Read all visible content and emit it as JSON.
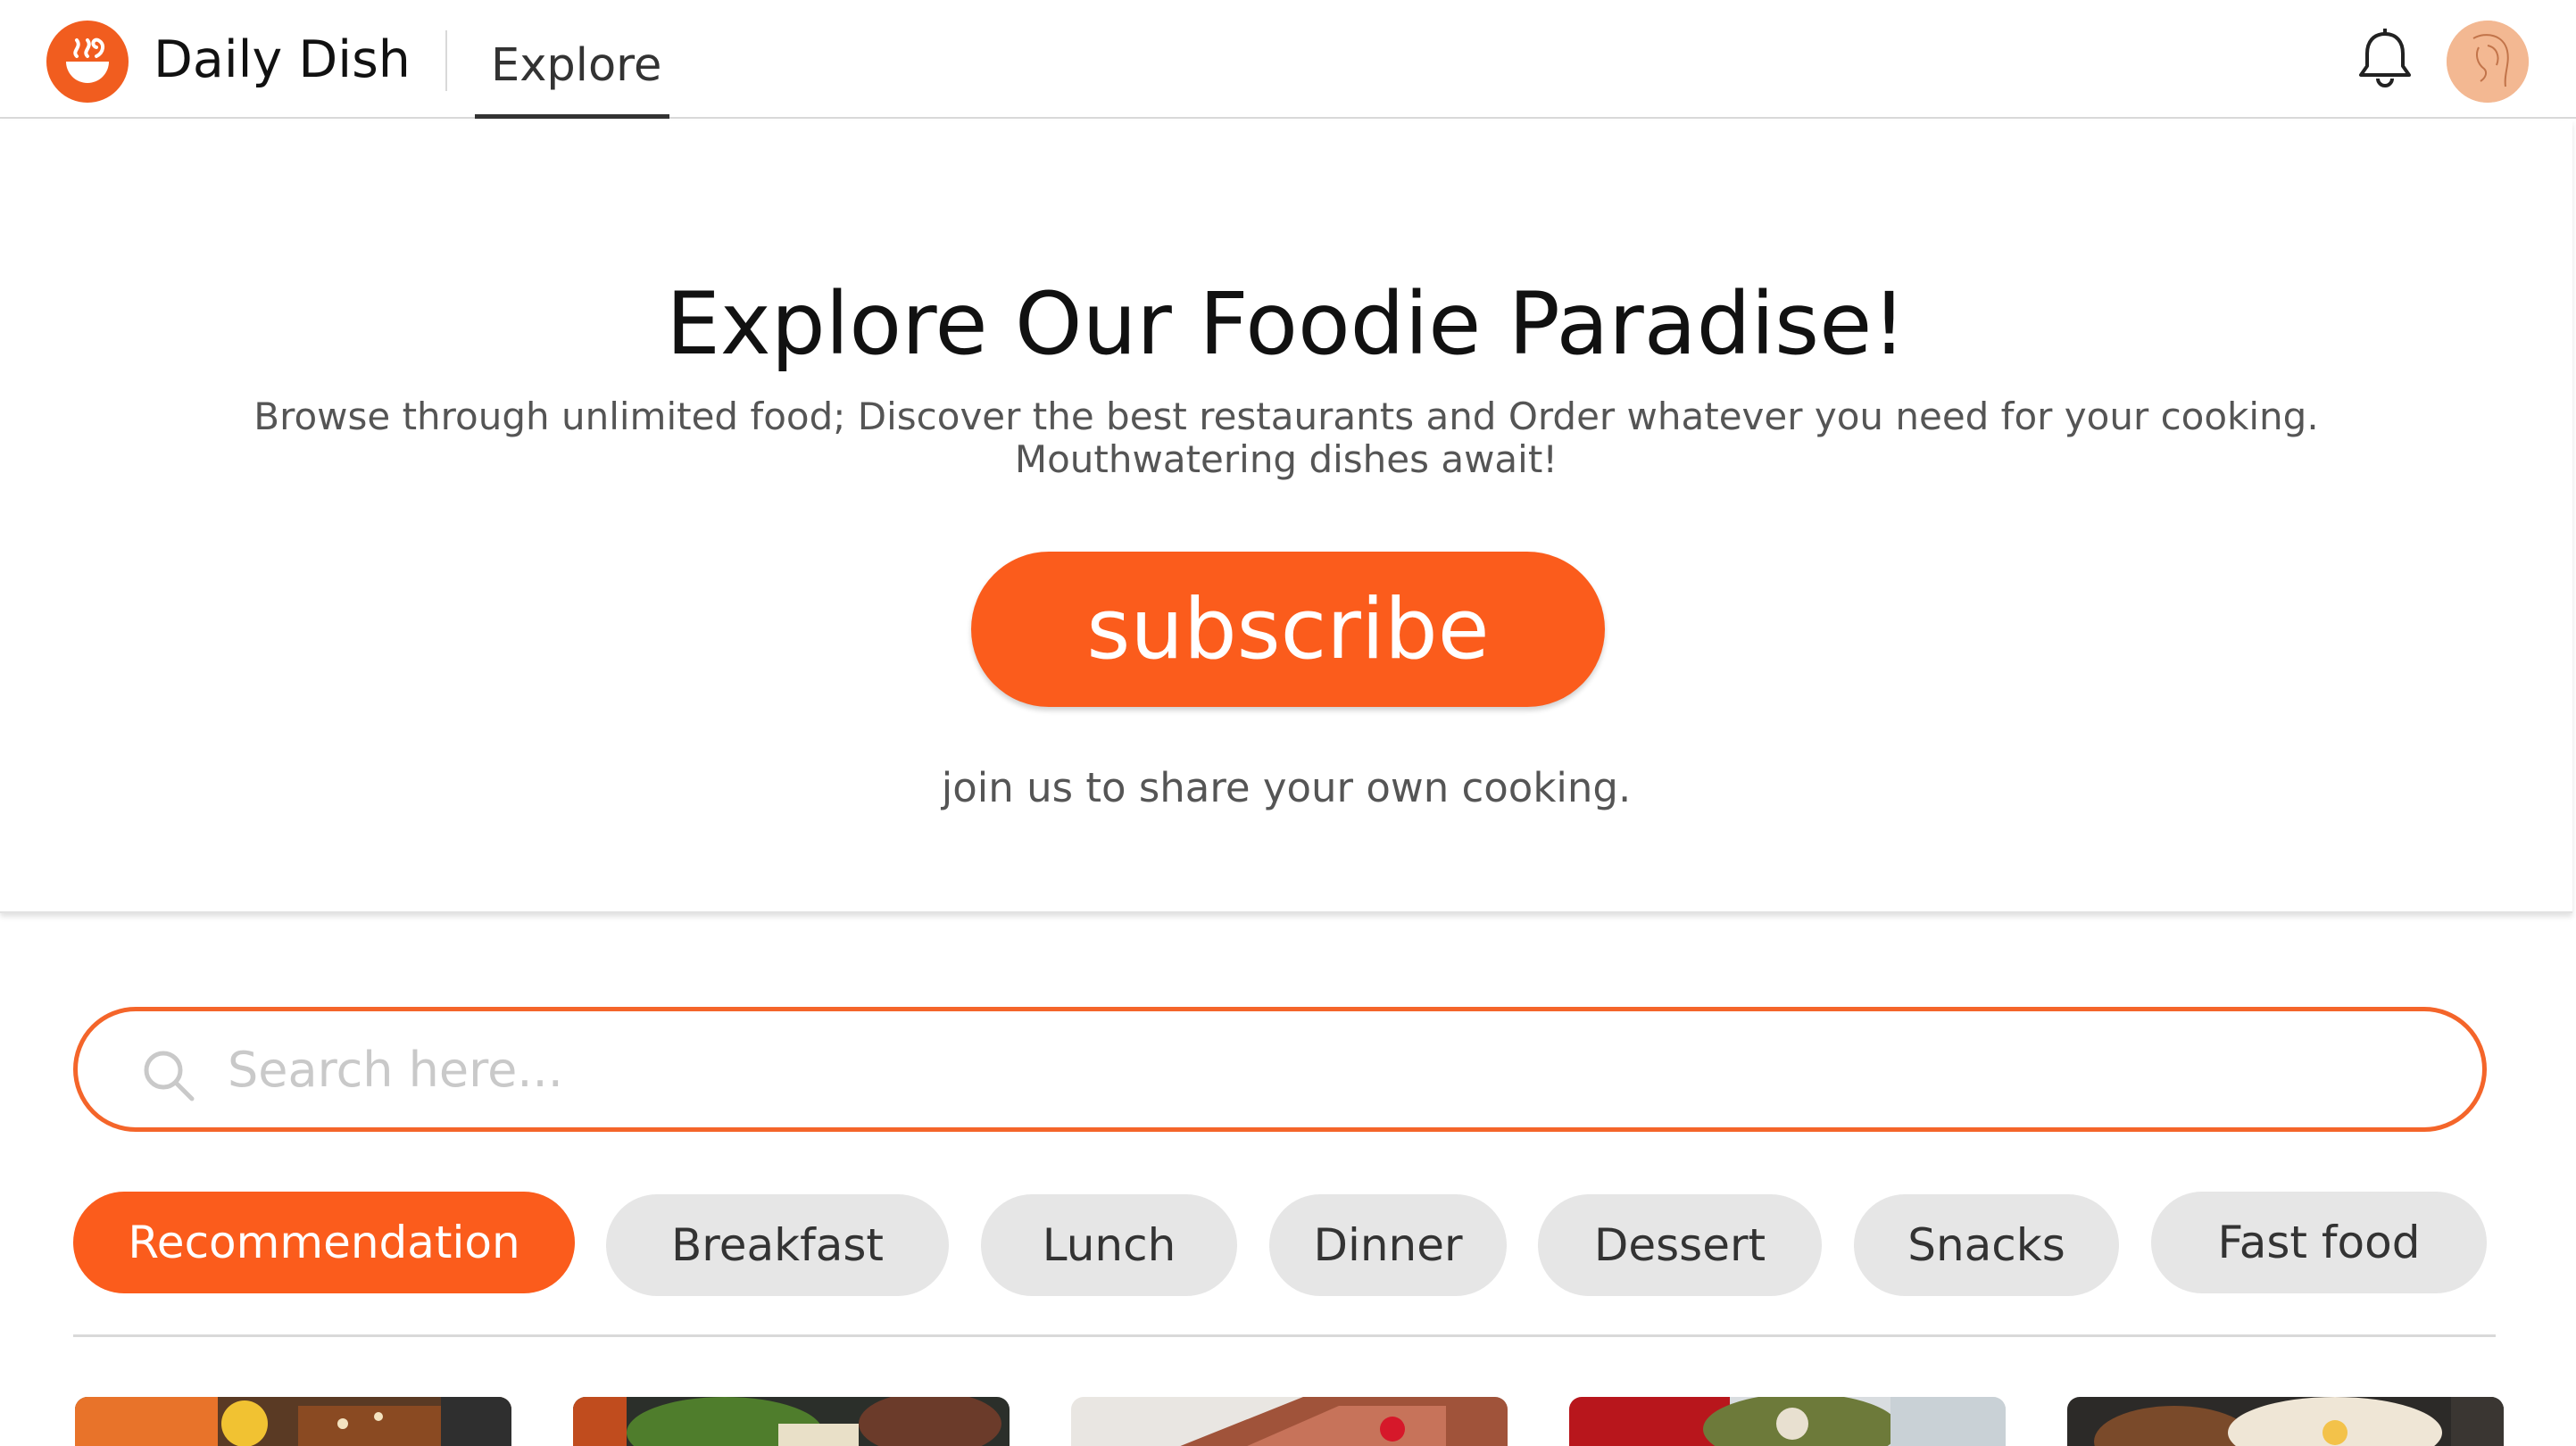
{
  "navbar": {
    "brand": "Daily Dish",
    "tab": "Explore"
  },
  "hero": {
    "title": "Explore Our Foodie Paradise!",
    "subtitle_line1": "Browse through unlimited food; Discover the best restaurants and Order whatever you need for your cooking.",
    "subtitle_line2": "Mouthwatering dishes await!",
    "subscribe_label": "subscribe",
    "note": "join us to share your own cooking."
  },
  "search": {
    "placeholder": "Search here..."
  },
  "categories": [
    {
      "label": "Recommendation",
      "active": true
    },
    {
      "label": "Breakfast",
      "active": false
    },
    {
      "label": "Lunch",
      "active": false
    },
    {
      "label": "Dinner",
      "active": false
    },
    {
      "label": "Dessert",
      "active": false
    },
    {
      "label": "Snacks",
      "active": false
    },
    {
      "label": "Fast food",
      "active": false
    }
  ],
  "colors": {
    "accent": "#fb5c1c",
    "chip_inactive": "#e6e6e6",
    "text_dark": "#111111",
    "text_muted": "#555555"
  },
  "icons": {
    "logo": "bowl-with-steam-icon",
    "notifications": "bell-icon",
    "profile": "avatar",
    "search": "search-icon"
  }
}
